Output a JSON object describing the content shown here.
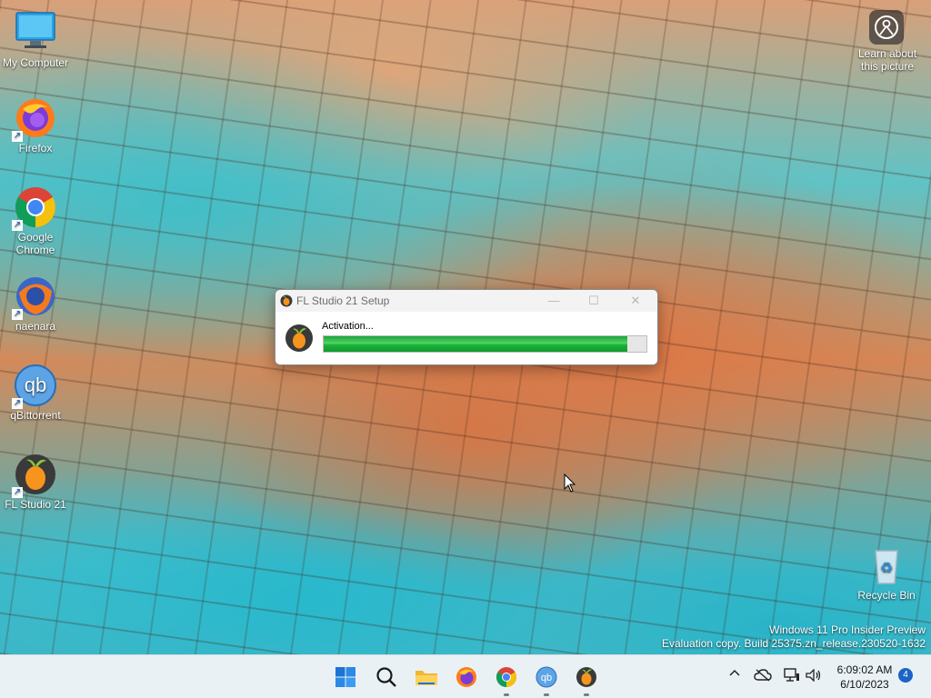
{
  "desktop": {
    "icons": [
      {
        "label": "My Computer",
        "icon": "monitor-icon"
      },
      {
        "label": "Firefox",
        "icon": "firefox-icon"
      },
      {
        "label": "Google Chrome",
        "icon": "chrome-icon"
      },
      {
        "label": "naenara",
        "icon": "naenara-icon"
      },
      {
        "label": "qBittorrent",
        "icon": "qbittorrent-icon"
      },
      {
        "label": "FL Studio 21",
        "icon": "fl-studio-icon"
      }
    ],
    "learn_about": "Learn about this picture",
    "recycle_bin": "Recycle Bin",
    "watermark_line1": "Windows 11 Pro Insider Preview",
    "watermark_line2": "Evaluation copy. Build 25375.zn_release.230520-1632"
  },
  "dialog": {
    "title": "FL Studio 21 Setup",
    "status": "Activation...",
    "progress": 0.94
  },
  "taskbar": {
    "apps": [
      "start-icon",
      "search-icon",
      "file-explorer-icon",
      "firefox-icon",
      "chrome-icon",
      "qbittorrent-icon",
      "fl-studio-icon"
    ],
    "time": "6:09:02 AM",
    "date": "6/10/2023",
    "notification_count": "4"
  },
  "colors": {
    "progress_green": "#1db33b",
    "taskbar_bg": "#eaf1f5",
    "accent": "#1a64c8"
  }
}
